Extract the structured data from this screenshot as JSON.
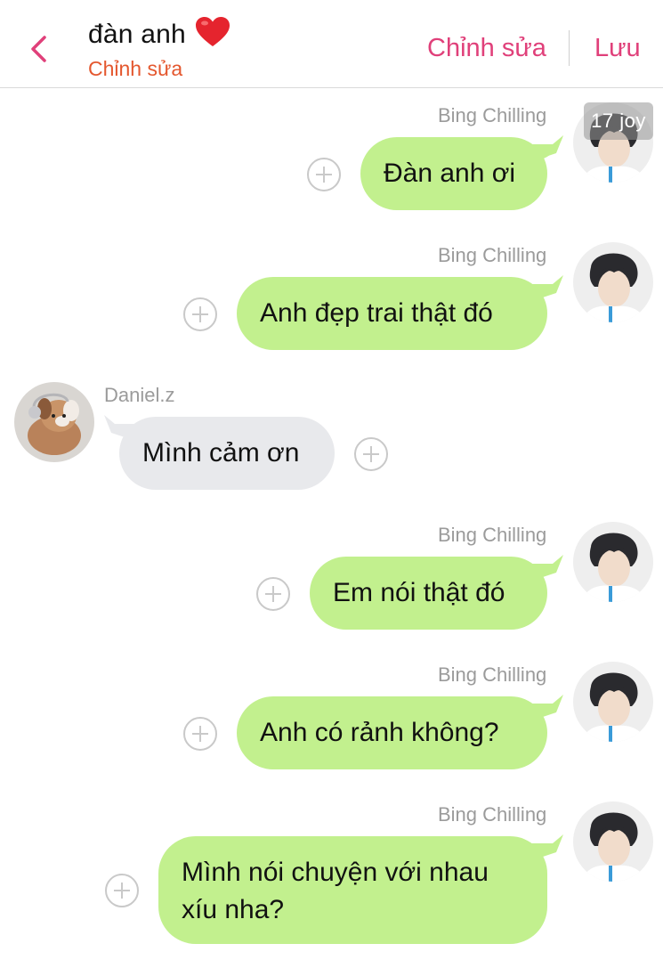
{
  "header": {
    "title": "đàn anh",
    "subtitle": "Chỉnh sửa",
    "edit_label": "Chỉnh sửa",
    "save_label": "Lưu"
  },
  "colors": {
    "accent": "#e0407a",
    "subtitle": "#e4572e",
    "my_bubble": "#c2f08e",
    "other_bubble": "#e8e9ec"
  },
  "avatar_badge": "17 joy",
  "messages": [
    {
      "sender": "Bing Chilling",
      "text": "Đàn anh ơi",
      "side": "right"
    },
    {
      "sender": "Bing Chilling",
      "text": "Anh đẹp trai thật đó",
      "side": "right"
    },
    {
      "sender": "Daniel.z",
      "text": "Mình cảm ơn",
      "side": "left"
    },
    {
      "sender": "Bing Chilling",
      "text": "Em nói thật đó",
      "side": "right"
    },
    {
      "sender": "Bing Chilling",
      "text": "Anh có rảnh không?",
      "side": "right"
    },
    {
      "sender": "Bing Chilling",
      "text": "Mình nói chuyện với nhau xíu nha?",
      "side": "right"
    }
  ]
}
